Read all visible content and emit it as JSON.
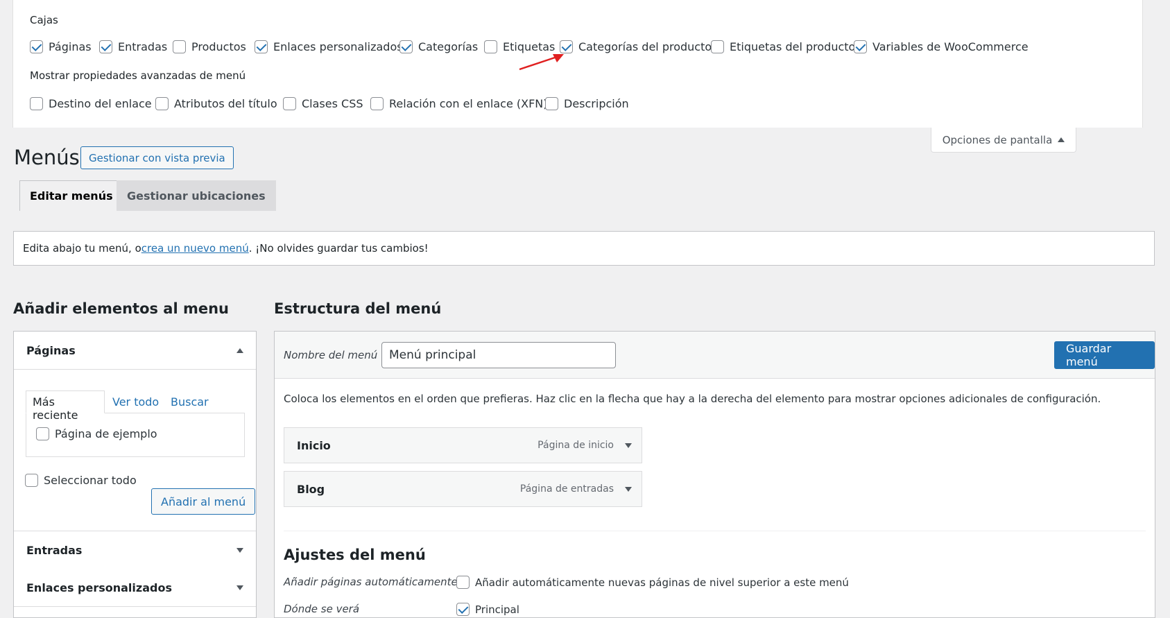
{
  "screen_options": {
    "boxes_title": "Cajas",
    "boxes": [
      {
        "label": "Páginas",
        "checked": true
      },
      {
        "label": "Entradas",
        "checked": true
      },
      {
        "label": "Productos",
        "checked": false
      },
      {
        "label": "Enlaces personalizados",
        "checked": true
      },
      {
        "label": "Categorías",
        "checked": true
      },
      {
        "label": "Etiquetas",
        "checked": false
      },
      {
        "label": "Categorías del producto",
        "checked": true
      },
      {
        "label": "Etiquetas del producto",
        "checked": false
      },
      {
        "label": "Variables de WooCommerce",
        "checked": true
      }
    ],
    "advanced_title": "Mostrar propiedades avanzadas de menú",
    "advanced": [
      {
        "label": "Destino del enlace",
        "checked": false
      },
      {
        "label": "Atributos del título",
        "checked": false
      },
      {
        "label": "Clases CSS",
        "checked": false
      },
      {
        "label": "Relación con el enlace (XFN)",
        "checked": false
      },
      {
        "label": "Descripción",
        "checked": false
      }
    ],
    "toggle_label": "Opciones de pantalla"
  },
  "header": {
    "title": "Menús",
    "preview_button": "Gestionar con vista previa",
    "tabs": [
      "Editar menús",
      "Gestionar ubicaciones"
    ]
  },
  "notice": {
    "before": "Edita abajo tu menú, o ",
    "link": "crea un nuevo menú",
    "after": ". ¡No olvides guardar tus cambios!"
  },
  "add_items": {
    "heading": "Añadir elementos al menu",
    "pages_section": "Páginas",
    "inner_tabs": [
      "Más reciente",
      "Ver todo",
      "Buscar"
    ],
    "page_item": "Página de ejemplo",
    "select_all": "Seleccionar todo",
    "add_button": "Añadir al menú",
    "posts_section": "Entradas",
    "links_section": "Enlaces personalizados"
  },
  "structure": {
    "heading": "Estructura del menú",
    "name_label": "Nombre del menú",
    "name_value": "Menú principal",
    "save_button": "Guardar menú",
    "instructions": "Coloca los elementos en el orden que prefieras. Haz clic en la flecha que hay a la derecha del elemento para mostrar opciones adicionales de configuración.",
    "items": [
      {
        "title": "Inicio",
        "type": "Página de inicio"
      },
      {
        "title": "Blog",
        "type": "Página de entradas"
      }
    ],
    "settings_heading": "Ajustes del menú",
    "auto_add_label": "Añadir páginas automáticamente",
    "auto_add_text": "Añadir automáticamente nuevas páginas de nivel superior a este menú",
    "auto_add_checked": false,
    "location_label": "Dónde se verá",
    "location_text": "Principal",
    "location_checked": true
  },
  "colors": {
    "accent": "#2271b1",
    "annotation_arrow": "#e02020"
  }
}
